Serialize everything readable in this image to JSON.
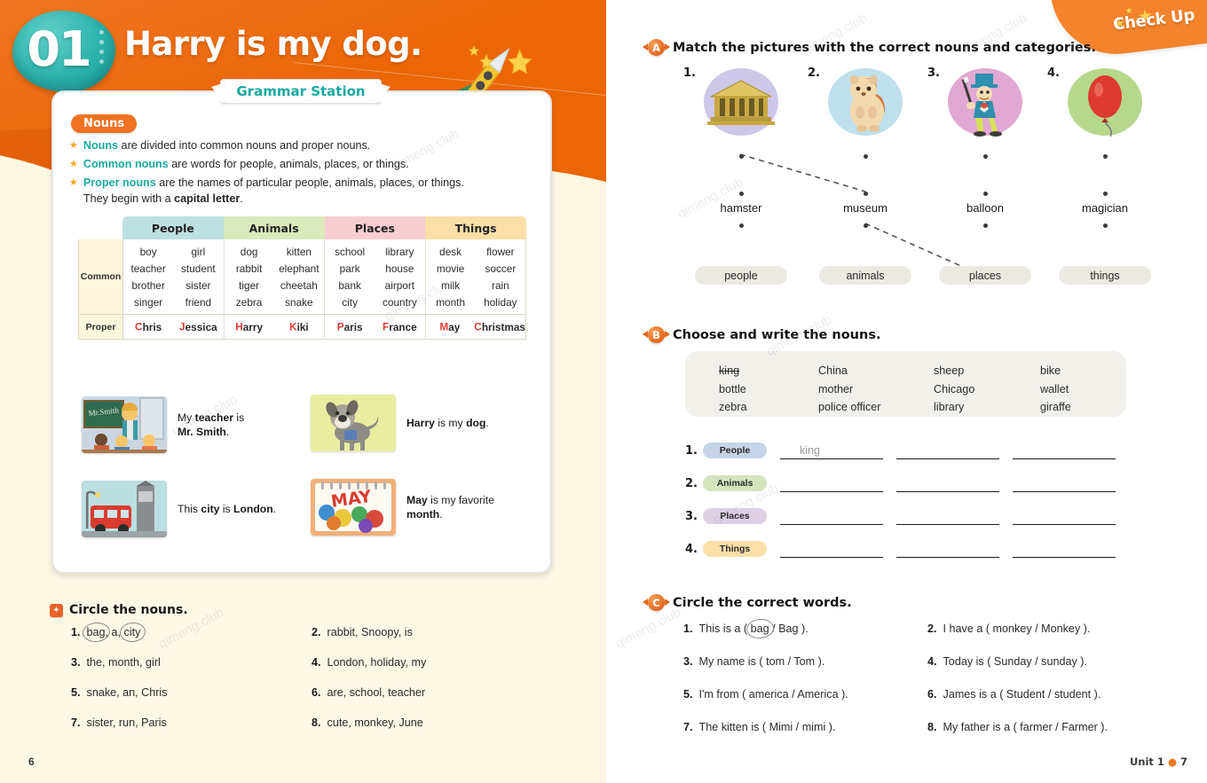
{
  "left": {
    "unit_number": "01",
    "unit_title": "Harry is my dog.",
    "grammar_station": "Grammar Station",
    "nouns_chip": "Nouns",
    "rules": [
      {
        "key": "Nouns",
        "rest": " are divided into common nouns and proper nouns."
      },
      {
        "key": "Common nouns",
        "rest": " are words for people, animals, places, or things."
      },
      {
        "key": "Proper nouns",
        "rest": " are the names of particular people, animals, places, or things.",
        "cont_pre": "They begin with a ",
        "cont_bold": "capital letter",
        "cont_post": "."
      }
    ],
    "table": {
      "headers": [
        "People",
        "Animals",
        "Places",
        "Things"
      ],
      "row_labels": [
        "Common",
        "Proper"
      ],
      "common": [
        [
          [
            "boy",
            "girl"
          ],
          [
            "teacher",
            "student"
          ],
          [
            "brother",
            "sister"
          ],
          [
            "singer",
            "friend"
          ]
        ],
        [
          [
            "dog",
            "kitten"
          ],
          [
            "rabbit",
            "elephant"
          ],
          [
            "tiger",
            "cheetah"
          ],
          [
            "zebra",
            "snake"
          ]
        ],
        [
          [
            "school",
            "library"
          ],
          [
            "park",
            "house"
          ],
          [
            "bank",
            "airport"
          ],
          [
            "city",
            "country"
          ]
        ],
        [
          [
            "desk",
            "flower"
          ],
          [
            "movie",
            "soccer"
          ],
          [
            "milk",
            "rain"
          ],
          [
            "month",
            "holiday"
          ]
        ]
      ],
      "proper": [
        [
          {
            "cap": "C",
            "rest": "hris"
          },
          {
            "cap": "J",
            "rest": "essica"
          }
        ],
        [
          {
            "cap": "H",
            "rest": "arry"
          },
          {
            "cap": "K",
            "rest": "iki"
          }
        ],
        [
          {
            "cap": "P",
            "rest": "aris"
          },
          {
            "cap": "F",
            "rest": "rance"
          }
        ],
        [
          {
            "cap": "M",
            "rest": "ay"
          },
          {
            "cap": "C",
            "rest": "hristmas"
          }
        ]
      ]
    },
    "examples": [
      {
        "image": "classroom-teacher-picture",
        "pre": "My ",
        "b1": "teacher",
        "mid": " is ",
        "b2": "Mr. Smith",
        "post": "."
      },
      {
        "image": "dog-picture",
        "pre": "",
        "b1": "Harry",
        "mid": " is my ",
        "b2": "dog",
        "post": "."
      },
      {
        "image": "london-bus-picture",
        "pre": "This ",
        "b1": "city",
        "mid": " is ",
        "b2": "London",
        "post": "."
      },
      {
        "image": "may-calendar-picture",
        "pre": "",
        "b1": "May",
        "mid": " is my favorite ",
        "b2": "month",
        "post": "."
      }
    ],
    "exercise": {
      "title": "Circle the nouns.",
      "items": [
        {
          "n": "1.",
          "parts": [
            {
              "t": "bag",
              "circled": true
            },
            {
              "t": ", a, ",
              "circled": false
            },
            {
              "t": "city",
              "circled": true
            }
          ]
        },
        {
          "n": "2.",
          "text": "rabbit, Snoopy, is"
        },
        {
          "n": "3.",
          "text": "the, month, girl"
        },
        {
          "n": "4.",
          "text": "London, holiday, my"
        },
        {
          "n": "5.",
          "text": "snake, an, Chris"
        },
        {
          "n": "6.",
          "text": "are, school, teacher"
        },
        {
          "n": "7.",
          "text": "sister, run, Paris"
        },
        {
          "n": "8.",
          "text": "cute, monkey, June"
        }
      ]
    },
    "page_number": "6"
  },
  "right": {
    "check_up": "Check Up",
    "section_a": {
      "letter": "A",
      "title": "Match the pictures with the correct nouns and categories.",
      "items": [
        {
          "num": "1.",
          "image": "museum-picture",
          "word": "hamster"
        },
        {
          "num": "2.",
          "image": "hamster-picture",
          "word": "museum"
        },
        {
          "num": "3.",
          "image": "magician-picture",
          "word": "balloon"
        },
        {
          "num": "4.",
          "image": "balloon-picture",
          "word": "magician"
        }
      ],
      "categories": [
        "people",
        "animals",
        "places",
        "things"
      ]
    },
    "section_b": {
      "letter": "B",
      "title": "Choose and write the nouns.",
      "word_bank": [
        [
          {
            "w": "king",
            "used": true
          },
          {
            "w": "bottle",
            "used": false
          },
          {
            "w": "zebra",
            "used": false
          }
        ],
        [
          {
            "w": "China",
            "used": false
          },
          {
            "w": "mother",
            "used": false
          },
          {
            "w": "police officer",
            "used": false
          }
        ],
        [
          {
            "w": "sheep",
            "used": false
          },
          {
            "w": "Chicago",
            "used": false
          },
          {
            "w": "library",
            "used": false
          }
        ],
        [
          {
            "w": "bike",
            "used": false
          },
          {
            "w": "wallet",
            "used": false
          },
          {
            "w": "giraffe",
            "used": false
          }
        ]
      ],
      "rows": [
        {
          "n": "1.",
          "pill": "People",
          "color": "#c5d4e8",
          "answers": [
            "king",
            "",
            ""
          ]
        },
        {
          "n": "2.",
          "pill": "Animals",
          "color": "#d4e4bc",
          "answers": [
            "",
            "",
            ""
          ]
        },
        {
          "n": "3.",
          "pill": "Places",
          "color": "#ddd0e5",
          "answers": [
            "",
            "",
            ""
          ]
        },
        {
          "n": "4.",
          "pill": "Things",
          "color": "#fadfa8",
          "answers": [
            "",
            "",
            ""
          ]
        }
      ]
    },
    "section_c": {
      "letter": "C",
      "title": "Circle the correct words.",
      "items": [
        {
          "n": "1.",
          "pre": "This is a ( ",
          "opt1": "bag",
          "sep": " / ",
          "opt2": "Bag",
          "post": " ).",
          "circled": "opt1"
        },
        {
          "n": "2.",
          "pre": "I have a ( ",
          "opt1": "monkey",
          "sep": " / ",
          "opt2": "Monkey",
          "post": " ).",
          "circled": ""
        },
        {
          "n": "3.",
          "pre": "My name is ( ",
          "opt1": "tom",
          "sep": " / ",
          "opt2": "Tom",
          "post": " ).",
          "circled": ""
        },
        {
          "n": "4.",
          "pre": "Today is ( ",
          "opt1": "Sunday",
          "sep": " / ",
          "opt2": "sunday",
          "post": " ).",
          "circled": ""
        },
        {
          "n": "5.",
          "pre": "I'm from ( ",
          "opt1": "america",
          "sep": " / ",
          "opt2": "America",
          "post": " ).",
          "circled": ""
        },
        {
          "n": "6.",
          "pre": "James is a ( ",
          "opt1": "Student",
          "sep": " / ",
          "opt2": "student",
          "post": " ).",
          "circled": ""
        },
        {
          "n": "7.",
          "pre": "The kitten is ( ",
          "opt1": "Mimi",
          "sep": " / ",
          "opt2": "mimi",
          "post": " ).",
          "circled": ""
        },
        {
          "n": "8.",
          "pre": "My father is a ( ",
          "opt1": "farmer",
          "sep": " / ",
          "opt2": "Farmer",
          "post": " ).",
          "circled": ""
        }
      ]
    },
    "footer_unit": "Unit 1",
    "footer_page": "7"
  },
  "watermark": "qimeng.club"
}
